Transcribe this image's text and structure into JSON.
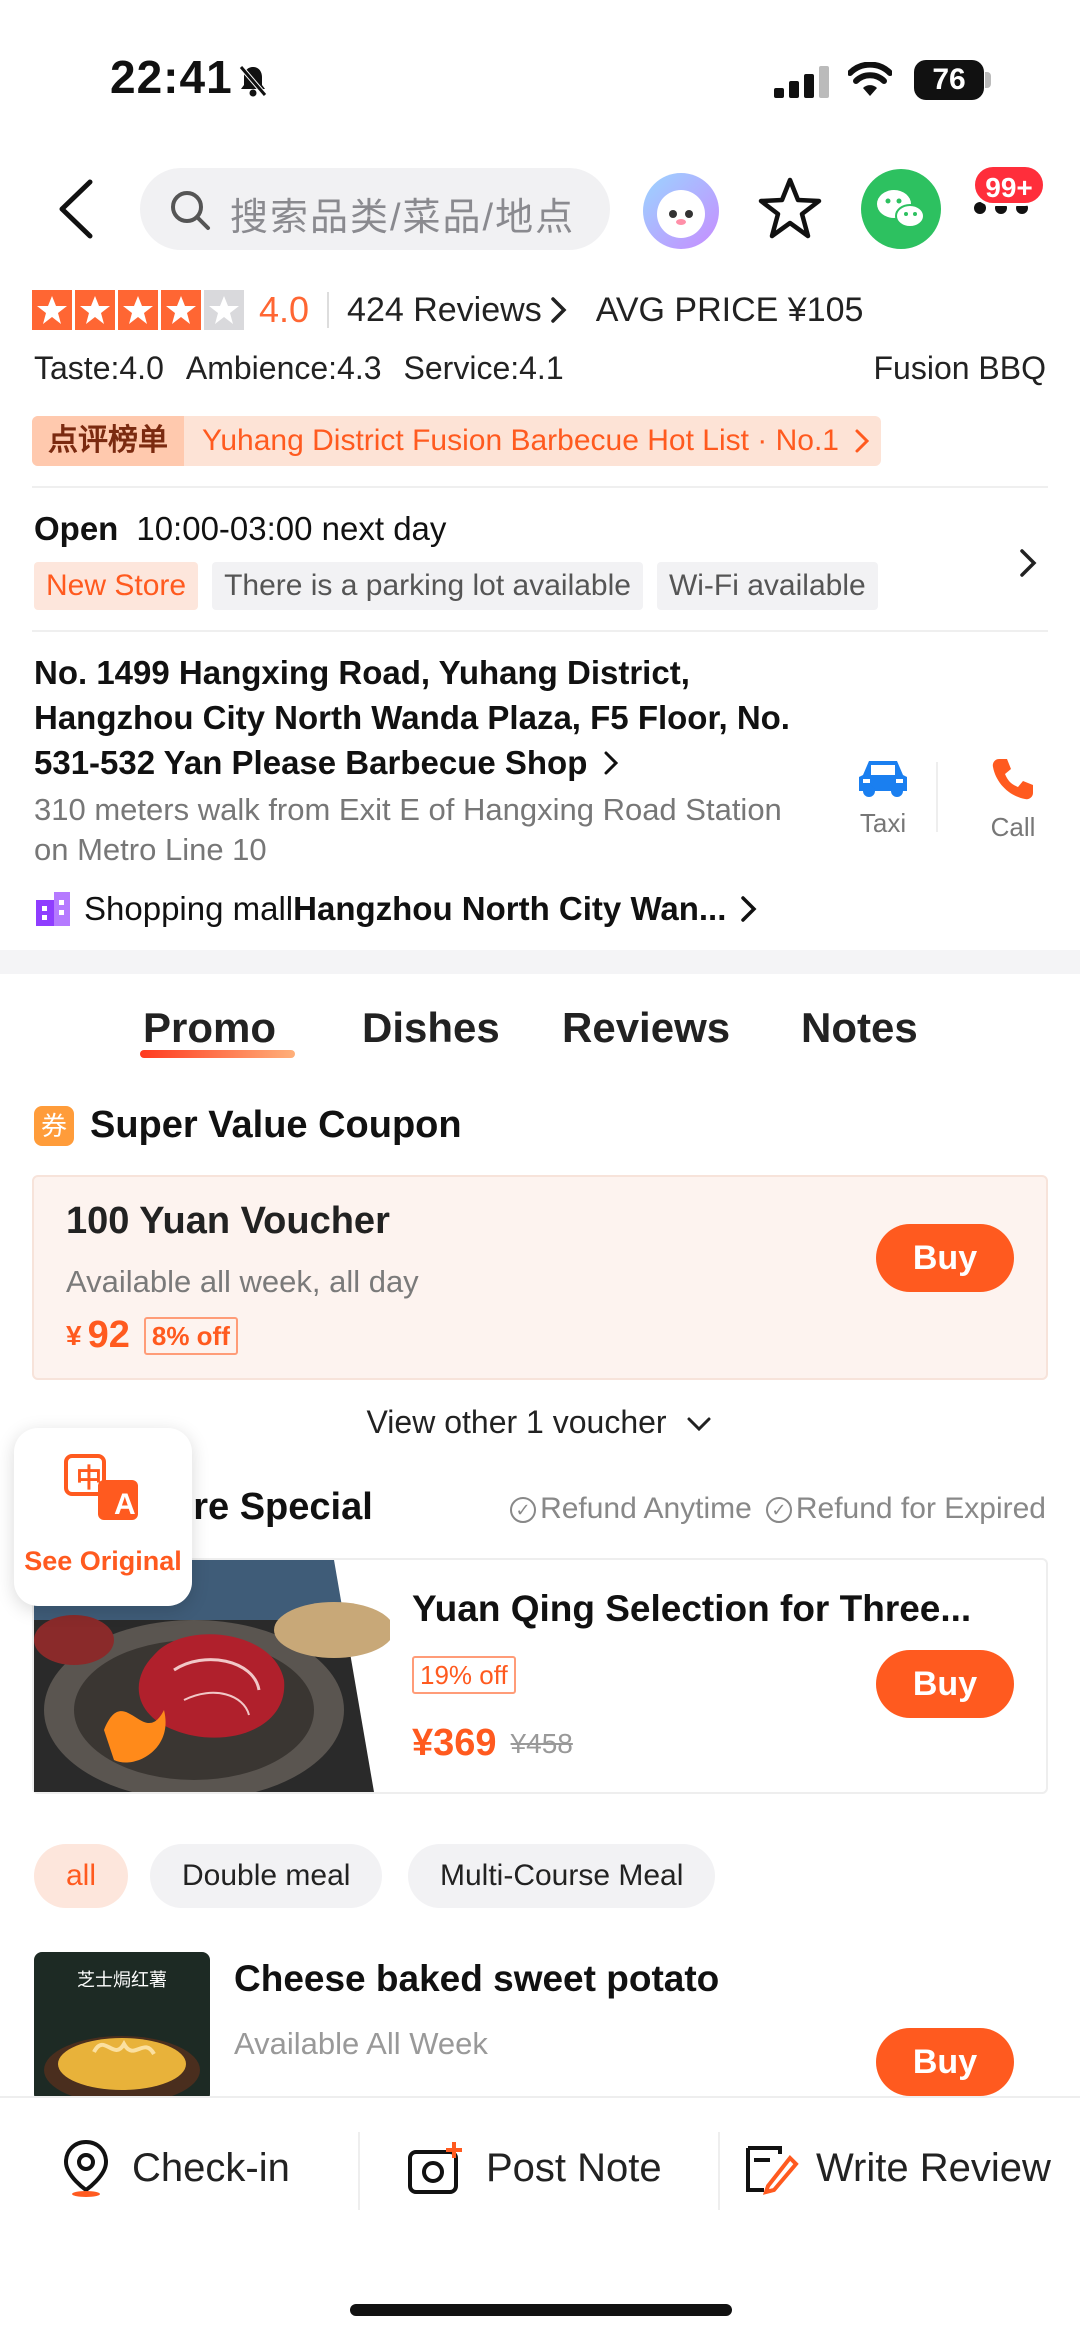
{
  "status_bar": {
    "time": "22:41",
    "battery": "76"
  },
  "header": {
    "search_placeholder": "搜索品类/菜品/地点",
    "notification_badge": "99+"
  },
  "shop": {
    "rating": "4.0",
    "stars_filled": 4,
    "stars_total": 5,
    "reviews": "424 Reviews",
    "avg_price": "AVG PRICE ¥105",
    "scores": {
      "taste": "Taste:4.0",
      "ambience": "Ambience:4.3",
      "service": "Service:4.1"
    },
    "category": "Fusion BBQ",
    "rank_tag": "点评榜单",
    "rank_text": "Yuhang District Fusion Barbecue Hot List · No.1",
    "open_label": "Open",
    "hours": "10:00-03:00 next day",
    "tags": [
      "New Store",
      "There is a parking lot available",
      "Wi-Fi available"
    ],
    "address": "No. 1499 Hangxing Road, Yuhang District, Hangzhou City North Wanda Plaza, F5 Floor, No. 531-532 Yan Please Barbecue Shop",
    "walk_info": "310 meters walk from Exit E of Hangxing Road Station on Metro Line 10",
    "taxi_label": "Taxi",
    "call_label": "Call",
    "mall_prefix": "Shopping mall",
    "mall_name": "Hangzhou North City Wan..."
  },
  "tabs": [
    "Promo",
    "Dishes",
    "Reviews",
    "Notes"
  ],
  "coupon_section": {
    "title": "Super Value Coupon",
    "icon_text": "券",
    "coupon": {
      "name": "100 Yuan Voucher",
      "availability": "Available all week, all day",
      "currency": "¥",
      "price": "92",
      "discount": "8% off",
      "buy_label": "Buy"
    },
    "view_more": "View other 1 voucher"
  },
  "store_special": {
    "title_visible": "ore Special",
    "refund_anytime": "Refund Anytime",
    "refund_expired": "Refund for Expired",
    "deal": {
      "title": "Yuan Qing Selection for Three...",
      "discount": "19% off",
      "price": "¥369",
      "original_price": "¥458",
      "buy_label": "Buy"
    }
  },
  "filter_chips": [
    "all",
    "Double meal",
    "Multi-Course Meal"
  ],
  "dish": {
    "title": "Cheese baked sweet potato",
    "availability": "Available All Week",
    "image_text": "芝士焗红薯",
    "buy_label": "Buy"
  },
  "translate_button": {
    "label": "See Original",
    "icon_text_cn": "中",
    "icon_text_en": "A"
  },
  "bottom_bar": {
    "check_in": "Check-in",
    "post_note": "Post Note",
    "write_review": "Write Review"
  },
  "colors": {
    "accent": "#ff5a1f",
    "wechat": "#2dc160",
    "taxi": "#1a7ff0"
  }
}
